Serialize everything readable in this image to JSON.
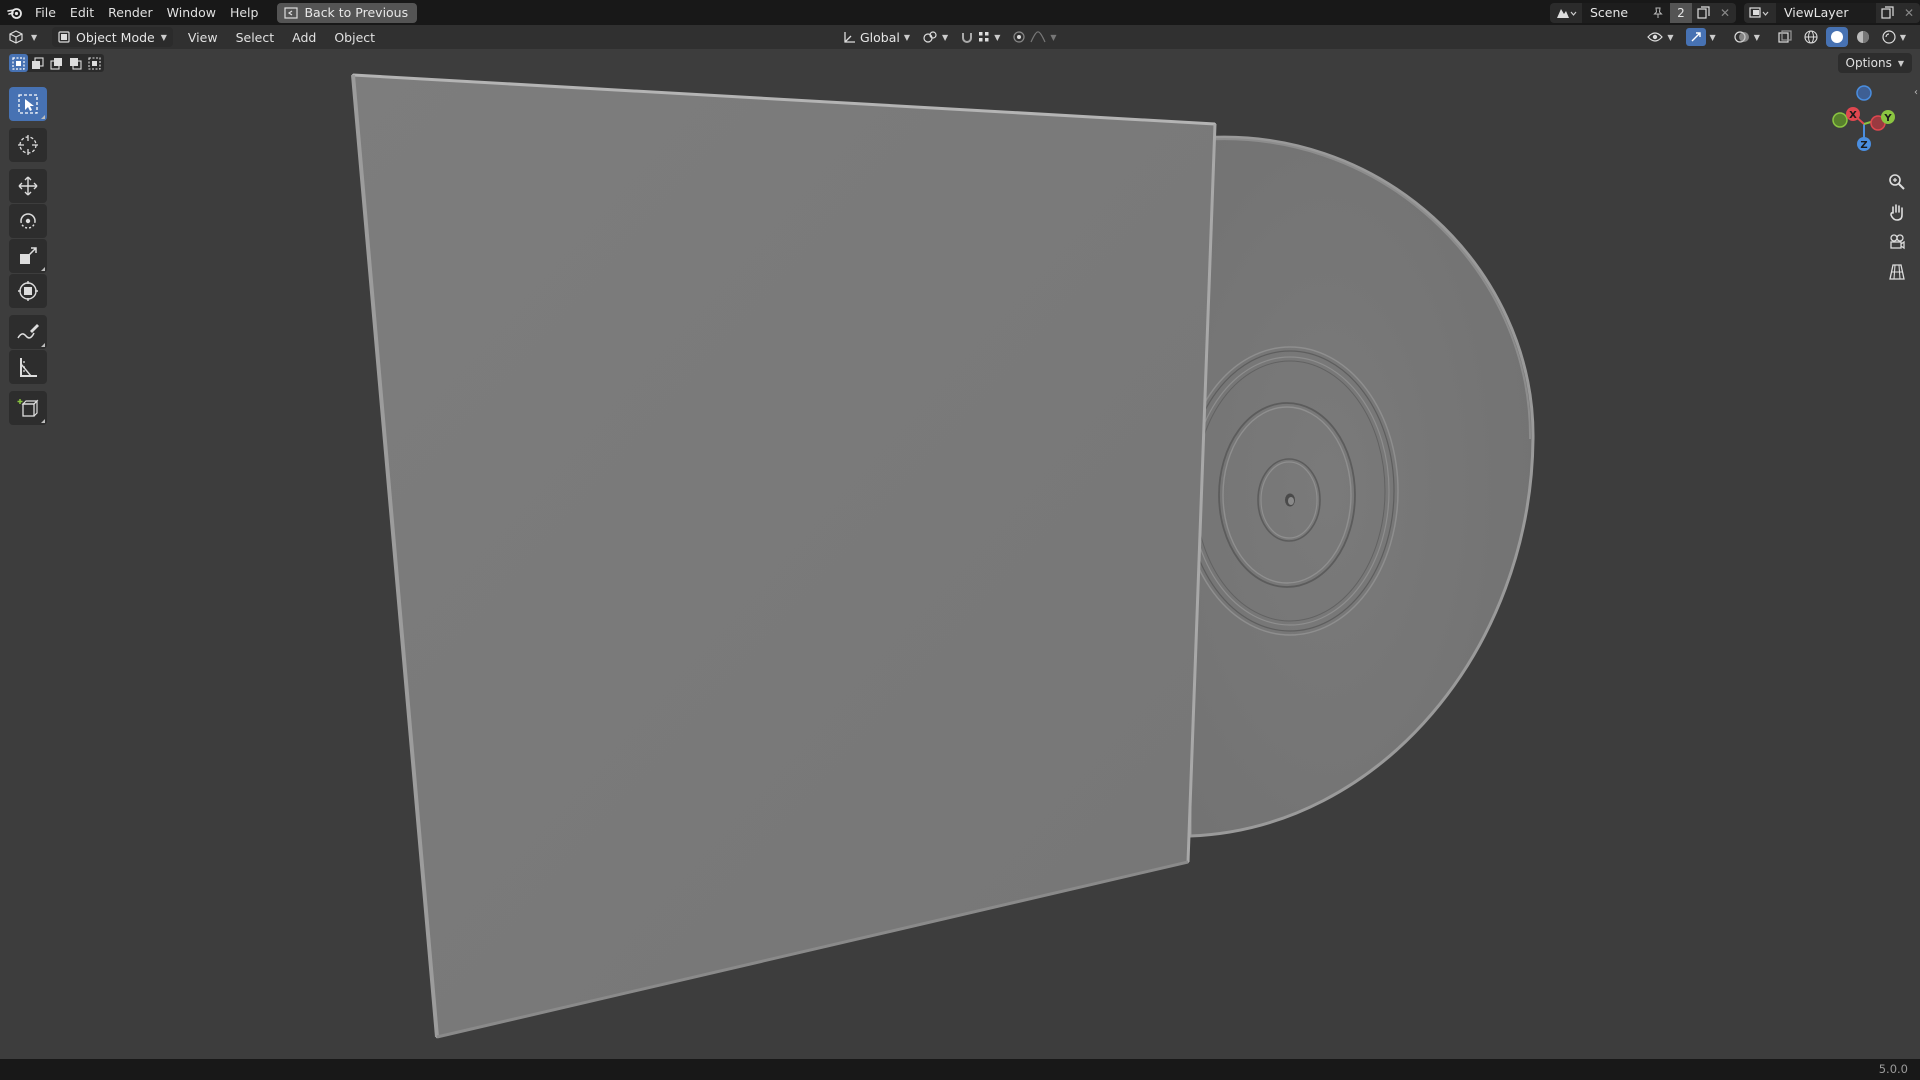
{
  "topbar": {
    "menus": [
      "File",
      "Edit",
      "Render",
      "Window",
      "Help"
    ],
    "back_button": "Back to Previous",
    "scene_name": "Scene",
    "users_count": "2",
    "view_layer": "ViewLayer"
  },
  "header": {
    "mode": "Object Mode",
    "menus": [
      "View",
      "Select",
      "Add",
      "Object"
    ],
    "transform_orientation": "Global"
  },
  "viewport": {
    "options_label": "Options",
    "gizmo": {
      "x_label": "X",
      "y_label": "Y",
      "z_label": "Z"
    }
  },
  "status": {
    "version": "5.0.0"
  },
  "colors": {
    "accent": "#4772b3",
    "x_axis": "#e0474f",
    "y_axis": "#8bc541",
    "z_axis": "#4a8ee0"
  }
}
